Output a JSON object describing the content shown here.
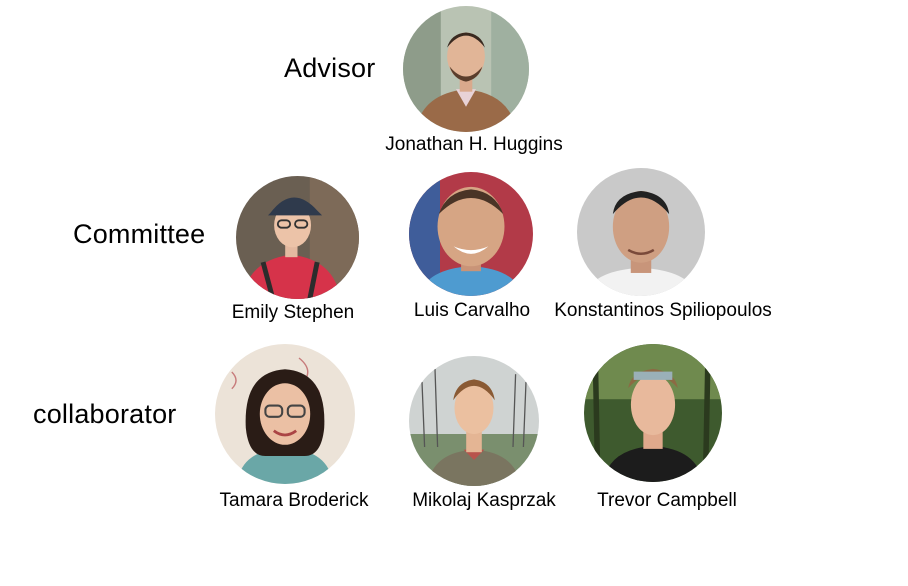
{
  "roles": {
    "advisor": "Advisor",
    "committee": "Committee",
    "collaborator": "collaborator"
  },
  "people": {
    "advisor": {
      "name": "Jonathan H. Huggins"
    },
    "committee": [
      {
        "name": "Emily Stephen"
      },
      {
        "name": "Luis Carvalho"
      },
      {
        "name": "Konstantinos Spiliopoulos"
      }
    ],
    "collaborators": [
      {
        "name": "Tamara Broderick"
      },
      {
        "name": "Mikolaj Kasprzak"
      },
      {
        "name": "Trevor Campbell"
      }
    ]
  }
}
